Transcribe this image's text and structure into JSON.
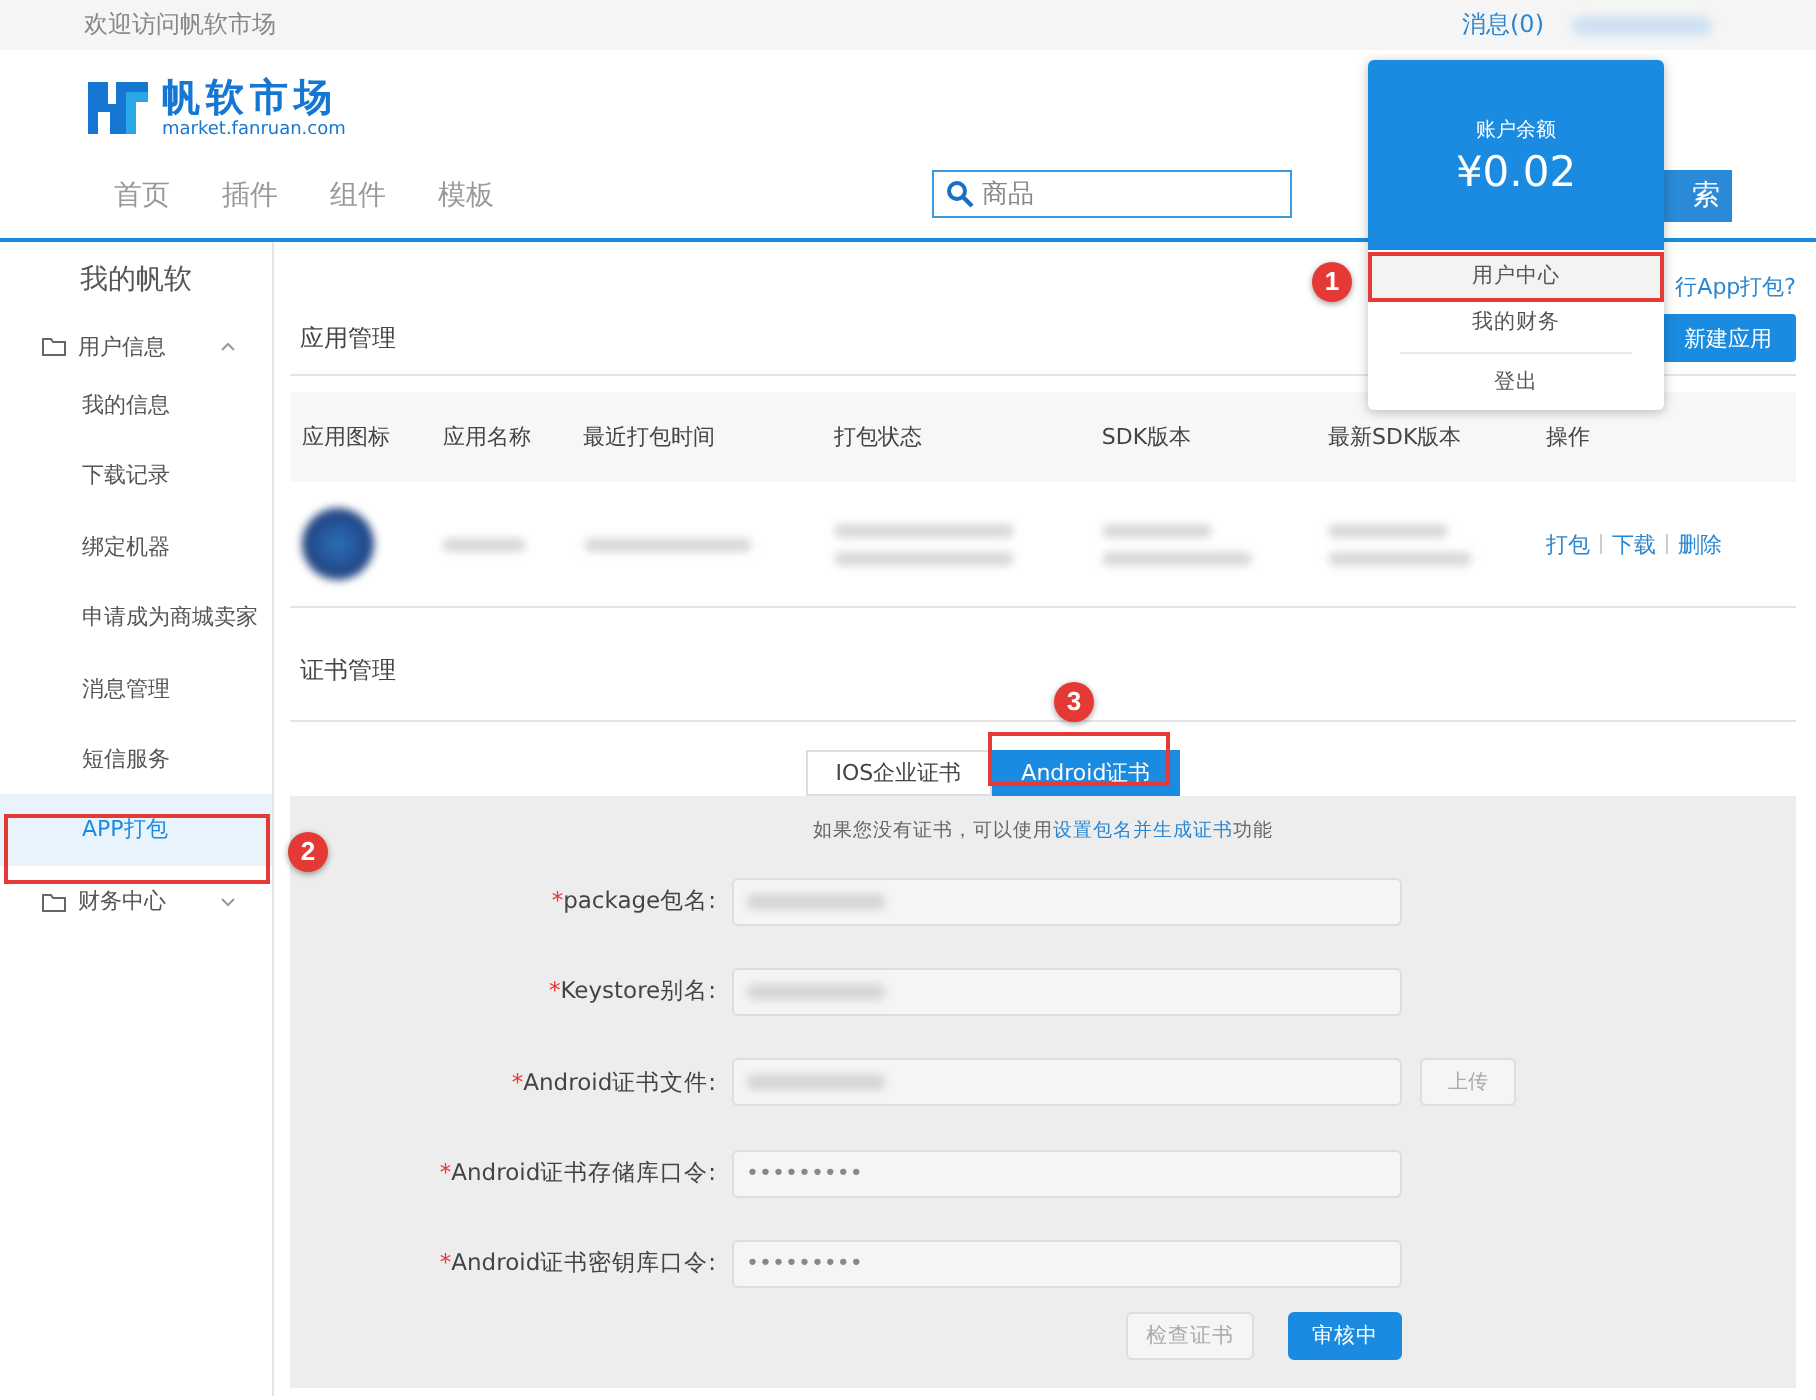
{
  "top_bar": {
    "welcome": "欢迎访问帆软市场",
    "messages": "消息(0)"
  },
  "logo": {
    "name": "帆软市场",
    "domain": "market.fanruan.com"
  },
  "nav": [
    "首页",
    "插件",
    "组件",
    "模板"
  ],
  "search": {
    "placeholder": "商品",
    "button": "索"
  },
  "account_menu": {
    "balance_label": "账户余额",
    "balance": "¥0.02",
    "items": [
      {
        "label": "用户中心",
        "selected": true
      },
      {
        "label": "我的财务",
        "selected": false
      },
      {
        "label": "登出",
        "selected": false
      }
    ]
  },
  "sidebar": {
    "title": "我的帆软",
    "groups": [
      {
        "label": "用户信息",
        "expanded": true,
        "children": [
          {
            "label": "我的信息",
            "selected": false
          },
          {
            "label": "下载记录",
            "selected": false
          },
          {
            "label": "绑定机器",
            "selected": false
          },
          {
            "label": "申请成为商城卖家",
            "selected": false
          },
          {
            "label": "消息管理",
            "selected": false
          },
          {
            "label": "短信服务",
            "selected": false
          },
          {
            "label": "APP打包",
            "selected": true
          }
        ]
      },
      {
        "label": "财务中心",
        "expanded": false
      }
    ]
  },
  "app_management": {
    "title": "应用管理",
    "help_link": "行App打包?",
    "new_button": "新建应用",
    "columns": [
      "应用图标",
      "应用名称",
      "最近打包时间",
      "打包状态",
      "SDK版本",
      "最新SDK版本",
      "操作"
    ],
    "rows": [
      {
        "actions": [
          "打包",
          "下载",
          "删除"
        ]
      }
    ]
  },
  "certificates": {
    "title": "证书管理",
    "tabs": [
      {
        "label": "IOS企业证书",
        "selected": false
      },
      {
        "label": "Android证书",
        "selected": true
      }
    ],
    "hint_before": "如果您没有证书，可以使用",
    "hint_link": "设置包名并生成证书",
    "hint_after": "功能",
    "fields": [
      {
        "required_mark": "*",
        "label": "package包名:",
        "kind": "text"
      },
      {
        "required_mark": "*",
        "label": "Keystore别名:",
        "kind": "text"
      },
      {
        "required_mark": "*",
        "label": "Android证书文件:",
        "kind": "file",
        "button": "上传"
      },
      {
        "required_mark": "*",
        "label": "Android证书存储库口令:",
        "kind": "password",
        "value": "•••••••••"
      },
      {
        "required_mark": "*",
        "label": "Android证书密钥库口令:",
        "kind": "password",
        "value": "•••••••••"
      }
    ],
    "buttons": [
      {
        "label": "检查证书",
        "kind": "default"
      },
      {
        "label": "审核中",
        "kind": "primary"
      }
    ]
  },
  "annotations": [
    {
      "number": "1"
    },
    {
      "number": "2"
    },
    {
      "number": "3"
    }
  ]
}
